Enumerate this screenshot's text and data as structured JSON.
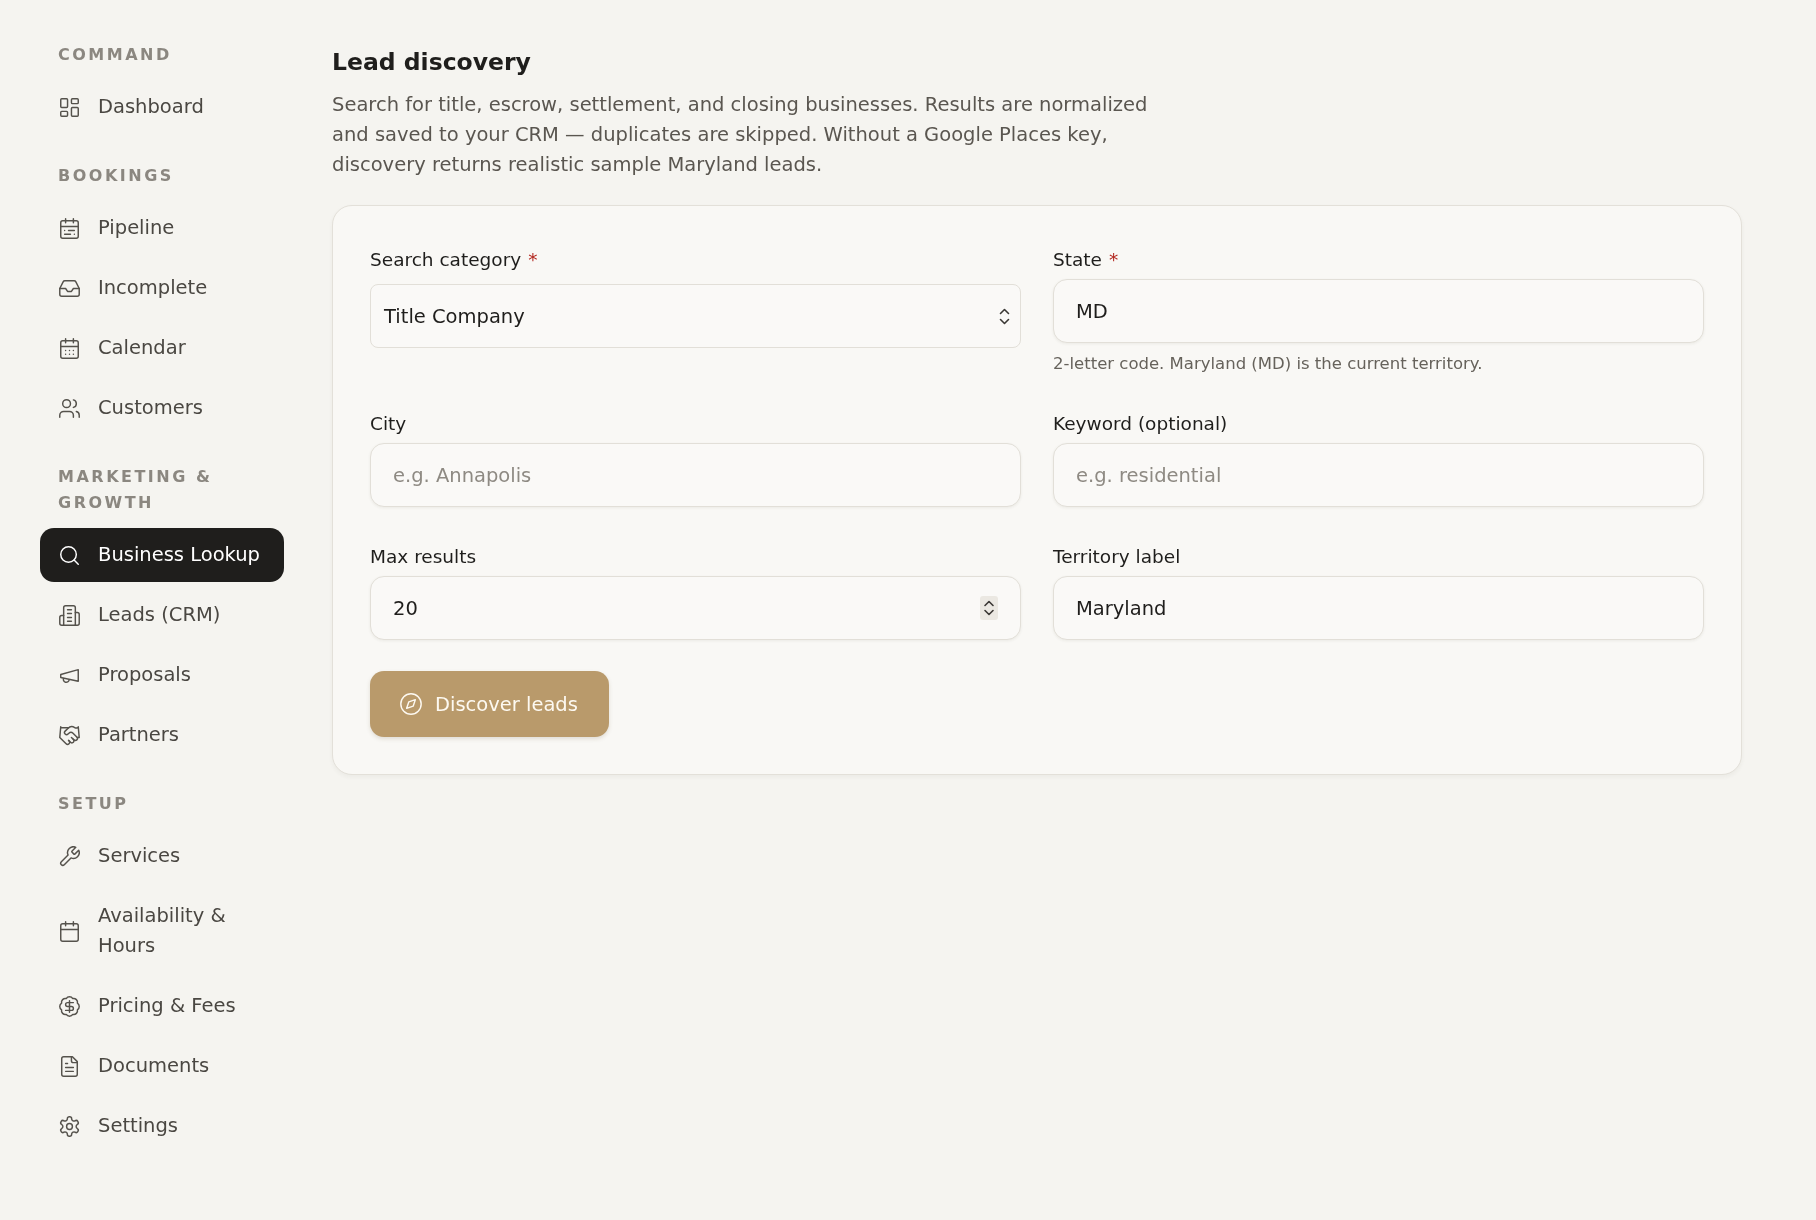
{
  "sidebar": {
    "sections": [
      {
        "heading": "COMMAND",
        "items": [
          {
            "label": "Dashboard",
            "selected": false
          }
        ]
      },
      {
        "heading": "BOOKINGS",
        "items": [
          {
            "label": "Pipeline",
            "selected": false
          },
          {
            "label": "Incomplete",
            "selected": false
          },
          {
            "label": "Calendar",
            "selected": false
          },
          {
            "label": "Customers",
            "selected": false
          }
        ]
      },
      {
        "heading": "MARKETING & GROWTH",
        "items": [
          {
            "label": "Business Lookup",
            "selected": true
          },
          {
            "label": "Leads (CRM)",
            "selected": false
          },
          {
            "label": "Proposals",
            "selected": false
          },
          {
            "label": "Partners",
            "selected": false
          }
        ]
      },
      {
        "heading": "SETUP",
        "items": [
          {
            "label": "Services",
            "selected": false
          },
          {
            "label": "Availability & Hours",
            "selected": false
          },
          {
            "label": "Pricing & Fees",
            "selected": false
          },
          {
            "label": "Documents",
            "selected": false
          },
          {
            "label": "Settings",
            "selected": false
          }
        ]
      }
    ]
  },
  "main": {
    "title": "Lead discovery",
    "description": "Search for title, escrow, settlement, and closing businesses. Results are normalized and saved to your CRM — duplicates are skipped. Without a Google Places key, discovery returns realistic sample Maryland leads.",
    "form": {
      "fields": [
        {
          "kind": "select",
          "label": "Search category",
          "required_mark": "*",
          "value": "Title Company"
        },
        {
          "kind": "text",
          "label": "State",
          "required_mark": "*",
          "value": "MD",
          "hint": "2-letter code. Maryland (MD) is the current territory."
        },
        {
          "kind": "text",
          "label": "City",
          "placeholder": "e.g. Annapolis"
        },
        {
          "kind": "text",
          "label": "Keyword (optional)",
          "placeholder": "e.g. residential"
        },
        {
          "kind": "number",
          "label": "Max results",
          "value": "20"
        },
        {
          "kind": "text",
          "label": "Territory label",
          "value": "Maryland"
        }
      ],
      "submit": {
        "label": "Discover leads"
      }
    }
  }
}
